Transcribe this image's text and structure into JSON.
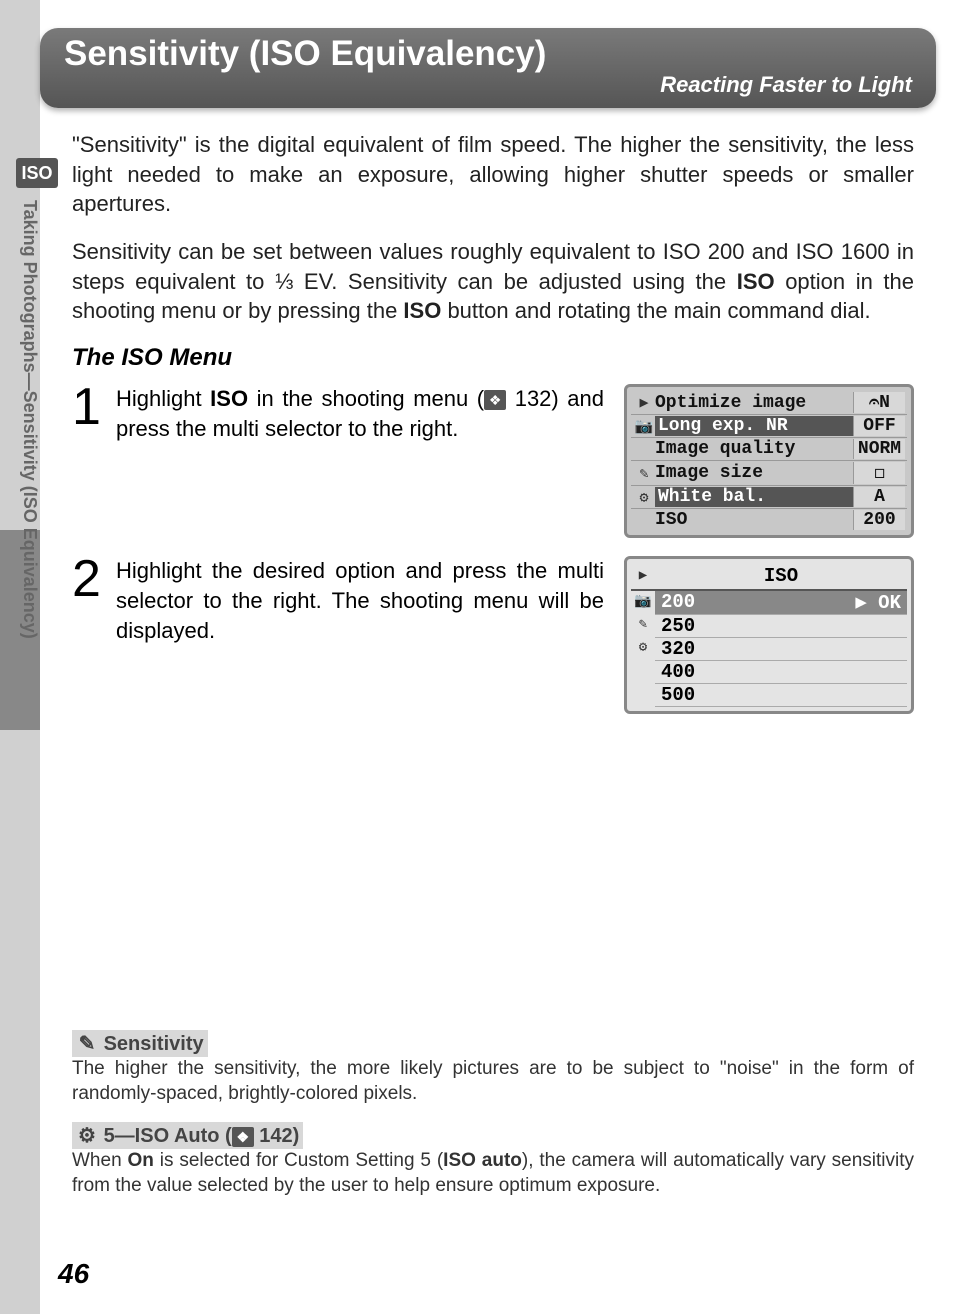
{
  "sidebar": {
    "iso_badge": "ISO",
    "vertical_text": "Taking Photographs—Sensitivity (ISO Equivalency)"
  },
  "header": {
    "title": "Sensitivity (ISO Equivalency)",
    "subtitle": "Reacting Faster to Light"
  },
  "paragraphs": {
    "intro": "\"Sensitivity\" is the digital equivalent of film speed.  The higher the sensitivity, the less light needed to make an exposure, allowing higher shutter speeds or smaller apertures.",
    "range_a": "Sensitivity can be set between values roughly equivalent to ISO 200 and ISO 1600 in steps equivalent to ",
    "range_frac": "⅓",
    "range_b": " EV.  Sensitivity can be adjusted using the ",
    "range_iso": "ISO",
    "range_c": " option in the shooting menu or by pressing the ",
    "range_iso2": "ISO",
    "range_d": " button and rotating the main command dial."
  },
  "subhead": "The ISO Menu",
  "steps": {
    "s1_a": "Highlight ",
    "s1_iso": "ISO",
    "s1_b": " in the shooting menu (",
    "s1_pg": " 132) and press the multi selector to the right.",
    "s2": "Highlight the desired option and press the multi selector to the right.  The shooting menu will be displayed."
  },
  "lcd1": {
    "rows": [
      {
        "icon": "▶",
        "label": "Optimize image",
        "val": "𝄐N"
      },
      {
        "icon": "📷",
        "label": "Long exp. NR",
        "val": "OFF",
        "highlight": true
      },
      {
        "icon": "",
        "label": "Image quality",
        "val": "NORM"
      },
      {
        "icon": "✎",
        "label": "Image size",
        "val": "◻"
      },
      {
        "icon": "⚙",
        "label": "White bal.",
        "val": "A",
        "highlight": true
      },
      {
        "icon": "",
        "label": "ISO",
        "val": "200"
      }
    ]
  },
  "lcd2": {
    "title": "ISO",
    "icons": [
      "▶",
      "📷",
      "✎",
      "⚙"
    ],
    "items": [
      {
        "label": "200",
        "ok": "▶ OK",
        "sel": true
      },
      {
        "label": "250"
      },
      {
        "label": "320"
      },
      {
        "label": "400"
      },
      {
        "label": "500"
      }
    ]
  },
  "notes": {
    "n1_title": "Sensitivity",
    "n1_body": "The higher the sensitivity, the more likely pictures are to be subject to \"noise\" in the form of randomly-spaced, brightly-colored pixels.",
    "n2_title_a": "5—ISO Auto (",
    "n2_title_b": " 142)",
    "n2_body_a": "When ",
    "n2_on": "On",
    "n2_body_b": " is selected for Custom Setting 5 (",
    "n2_isoauto": "ISO auto",
    "n2_body_c": "), the camera will automatically vary sensitivity from the value selected by the user to help ensure optimum exposure."
  },
  "page_number": "46"
}
